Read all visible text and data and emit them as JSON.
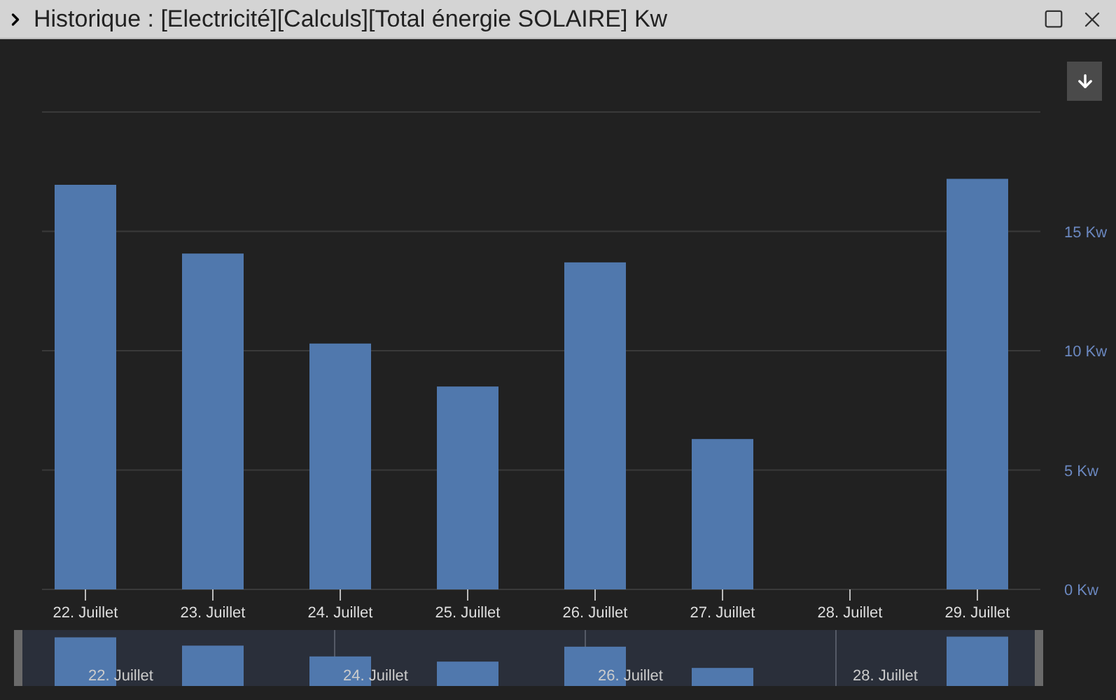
{
  "window": {
    "title": "Historique : [Electricité][Calculs][Total énergie SOLAIRE] Kw"
  },
  "chart": {
    "chart_data": {
      "type": "bar",
      "categories": [
        "22. Juillet",
        "23. Juillet",
        "24. Juillet",
        "25. Juillet",
        "26. Juillet",
        "27. Juillet",
        "28. Juillet",
        "29. Juillet"
      ],
      "series": [
        {
          "color": "#5078ad",
          "values": [
            16.95,
            14.07,
            10.3,
            8.5,
            13.7,
            6.3,
            0,
            17.2
          ]
        }
      ],
      "ylim": [
        0,
        20
      ],
      "grid": true,
      "yticks": [
        {
          "value": 0,
          "label": "0 Kw"
        },
        {
          "value": 5,
          "label": "5 Kw"
        },
        {
          "value": 10,
          "label": "10 Kw"
        },
        {
          "value": 15,
          "label": "15 Kw"
        }
      ]
    }
  },
  "navigator": {
    "labels": [
      "22. Juillet",
      "24. Juillet",
      "26. Juillet",
      "28. Juillet"
    ]
  }
}
